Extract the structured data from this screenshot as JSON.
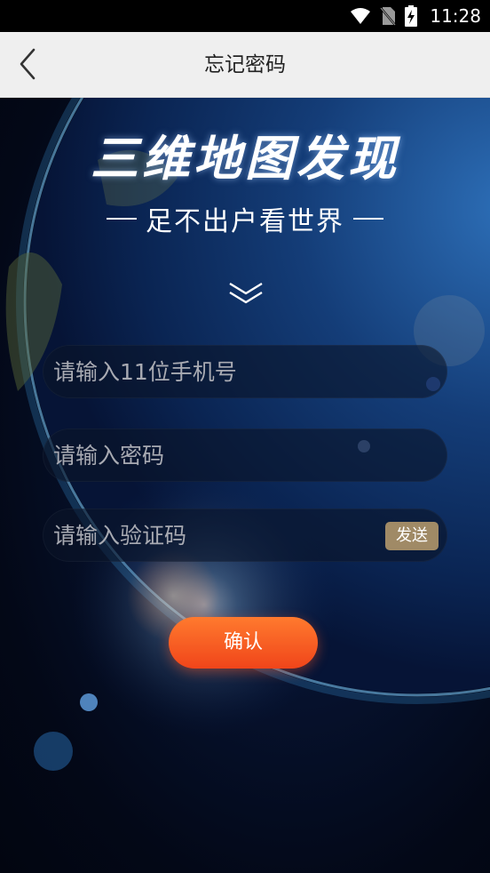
{
  "status_bar": {
    "time": "11:28",
    "icons": [
      "wifi-icon",
      "no-sim-icon",
      "battery-charging-icon"
    ]
  },
  "nav": {
    "back_icon": "chevron-left-icon",
    "title": "忘记密码"
  },
  "hero": {
    "headline": "三维地图发现",
    "tagline": "足不出户看世界",
    "scroll_icon": "double-chevron-down-icon"
  },
  "form": {
    "phone_placeholder": "请输入11位手机号",
    "password_placeholder": "请输入密码",
    "code_placeholder": "请输入验证码",
    "send_label": "发送",
    "confirm_label": "确认"
  },
  "colors": {
    "nav_bg": "#efefef",
    "send_button": "#a08a66",
    "confirm_button_top": "#ff7a2e",
    "confirm_button_bottom": "#f0451a"
  }
}
